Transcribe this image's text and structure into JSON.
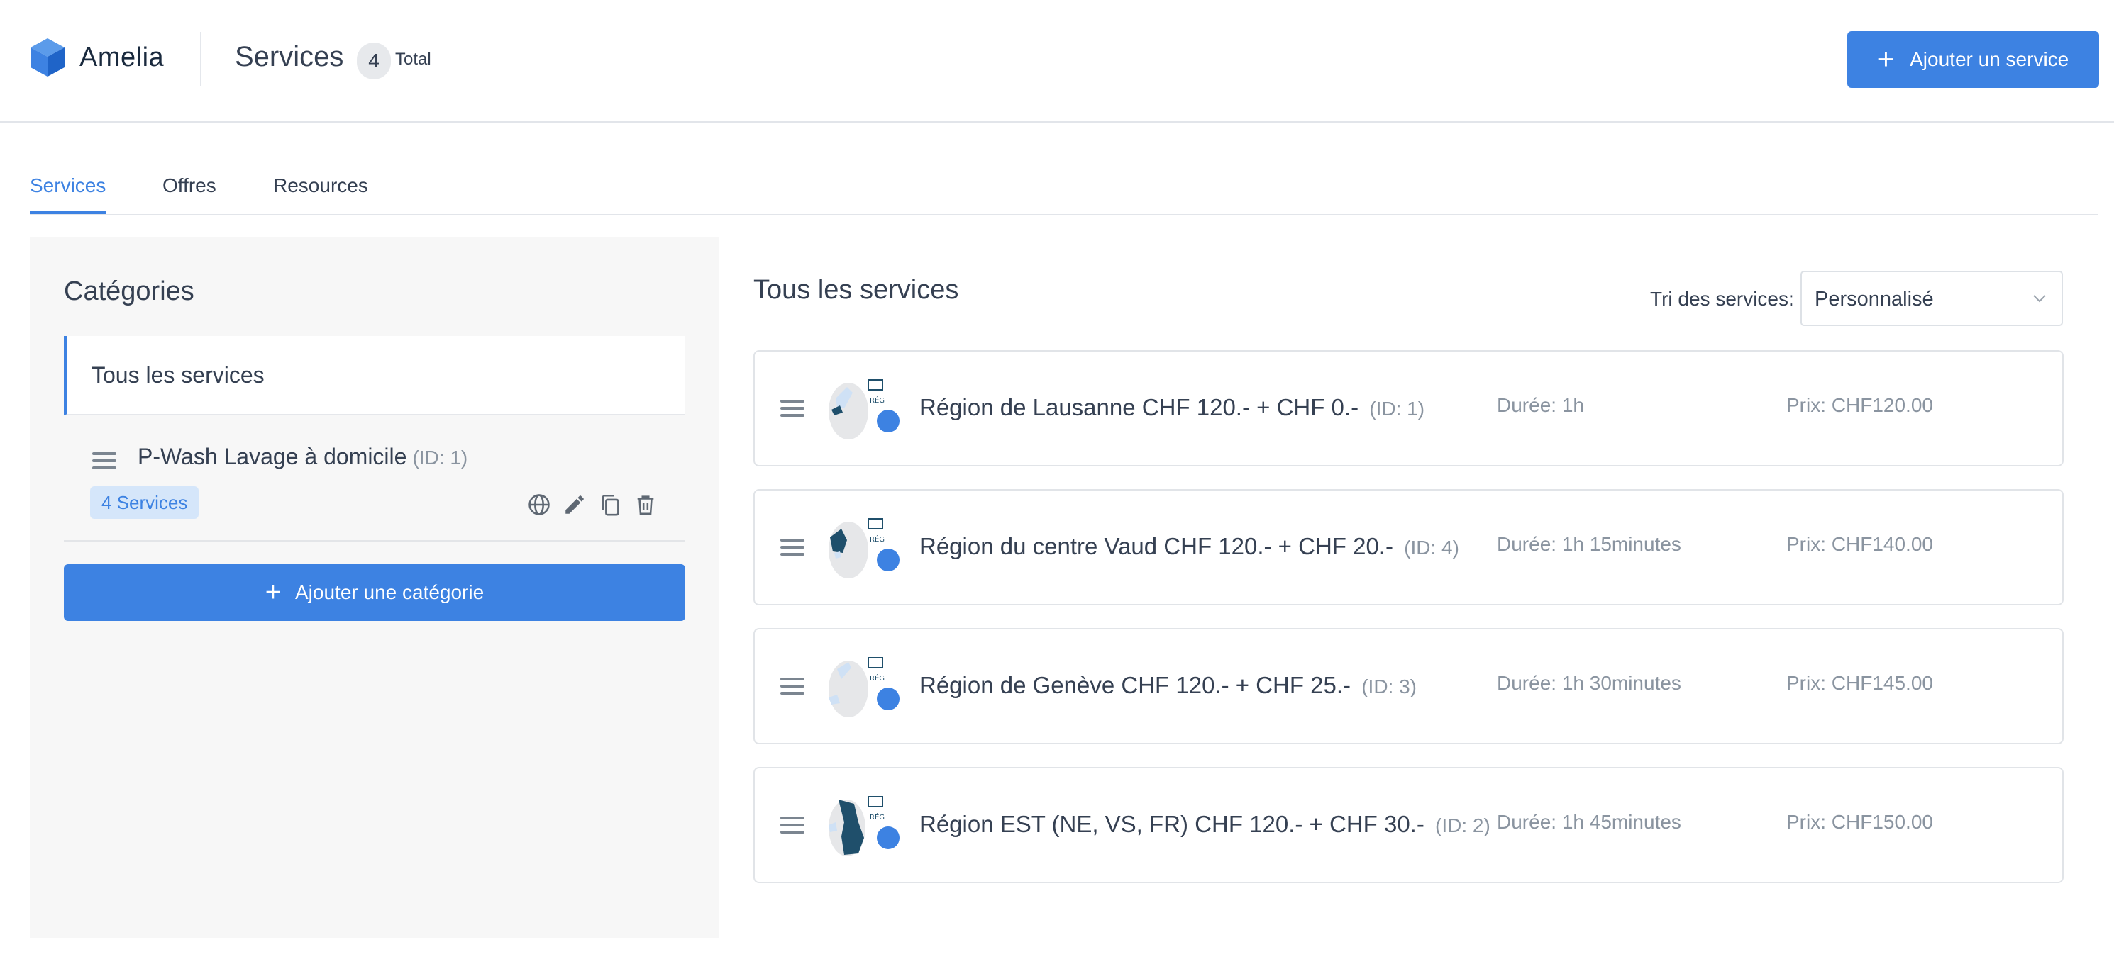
{
  "app": {
    "name": "Amelia"
  },
  "header": {
    "title": "Services",
    "total_count": "4",
    "total_label": "Total",
    "add_button_label": "Ajouter un service",
    "accent_color": "#3d82e2"
  },
  "tabs": [
    {
      "label": "Services",
      "active": true
    },
    {
      "label": "Offres",
      "active": false
    },
    {
      "label": "Resources",
      "active": false
    }
  ],
  "categories": {
    "title": "Catégories",
    "all_label": "Tous les services",
    "items": [
      {
        "name": "P-Wash Lavage à domicile",
        "id_label": "(ID: 1)",
        "services_badge": "4 Services",
        "actions": [
          "globe-icon",
          "edit-icon",
          "duplicate-icon",
          "delete-icon"
        ]
      }
    ],
    "add_button_label": "Ajouter une catégorie"
  },
  "services": {
    "title": "Tous les services",
    "sort_label": "Tri des services:",
    "sort_value": "Personnalisé",
    "items": [
      {
        "name": "Région de Lausanne CHF 120.- + CHF 0.-",
        "id_label": "(ID: 1)",
        "duration": "Durée: 1h",
        "price": "Prix: CHF120.00"
      },
      {
        "name": "Région du centre Vaud CHF 120.- + CHF 20.-",
        "id_label": "(ID: 4)",
        "duration": "Durée: 1h 15minutes",
        "price": "Prix: CHF140.00"
      },
      {
        "name": "Région de Genève CHF 120.- + CHF 25.-",
        "id_label": "(ID: 3)",
        "duration": "Durée: 1h 30minutes",
        "price": "Prix: CHF145.00"
      },
      {
        "name": "Région EST (NE, VS, FR) CHF 120.- + CHF 30.-",
        "id_label": "(ID: 2)",
        "duration": "Durée: 1h 45minutes",
        "price": "Prix: CHF150.00"
      }
    ]
  }
}
